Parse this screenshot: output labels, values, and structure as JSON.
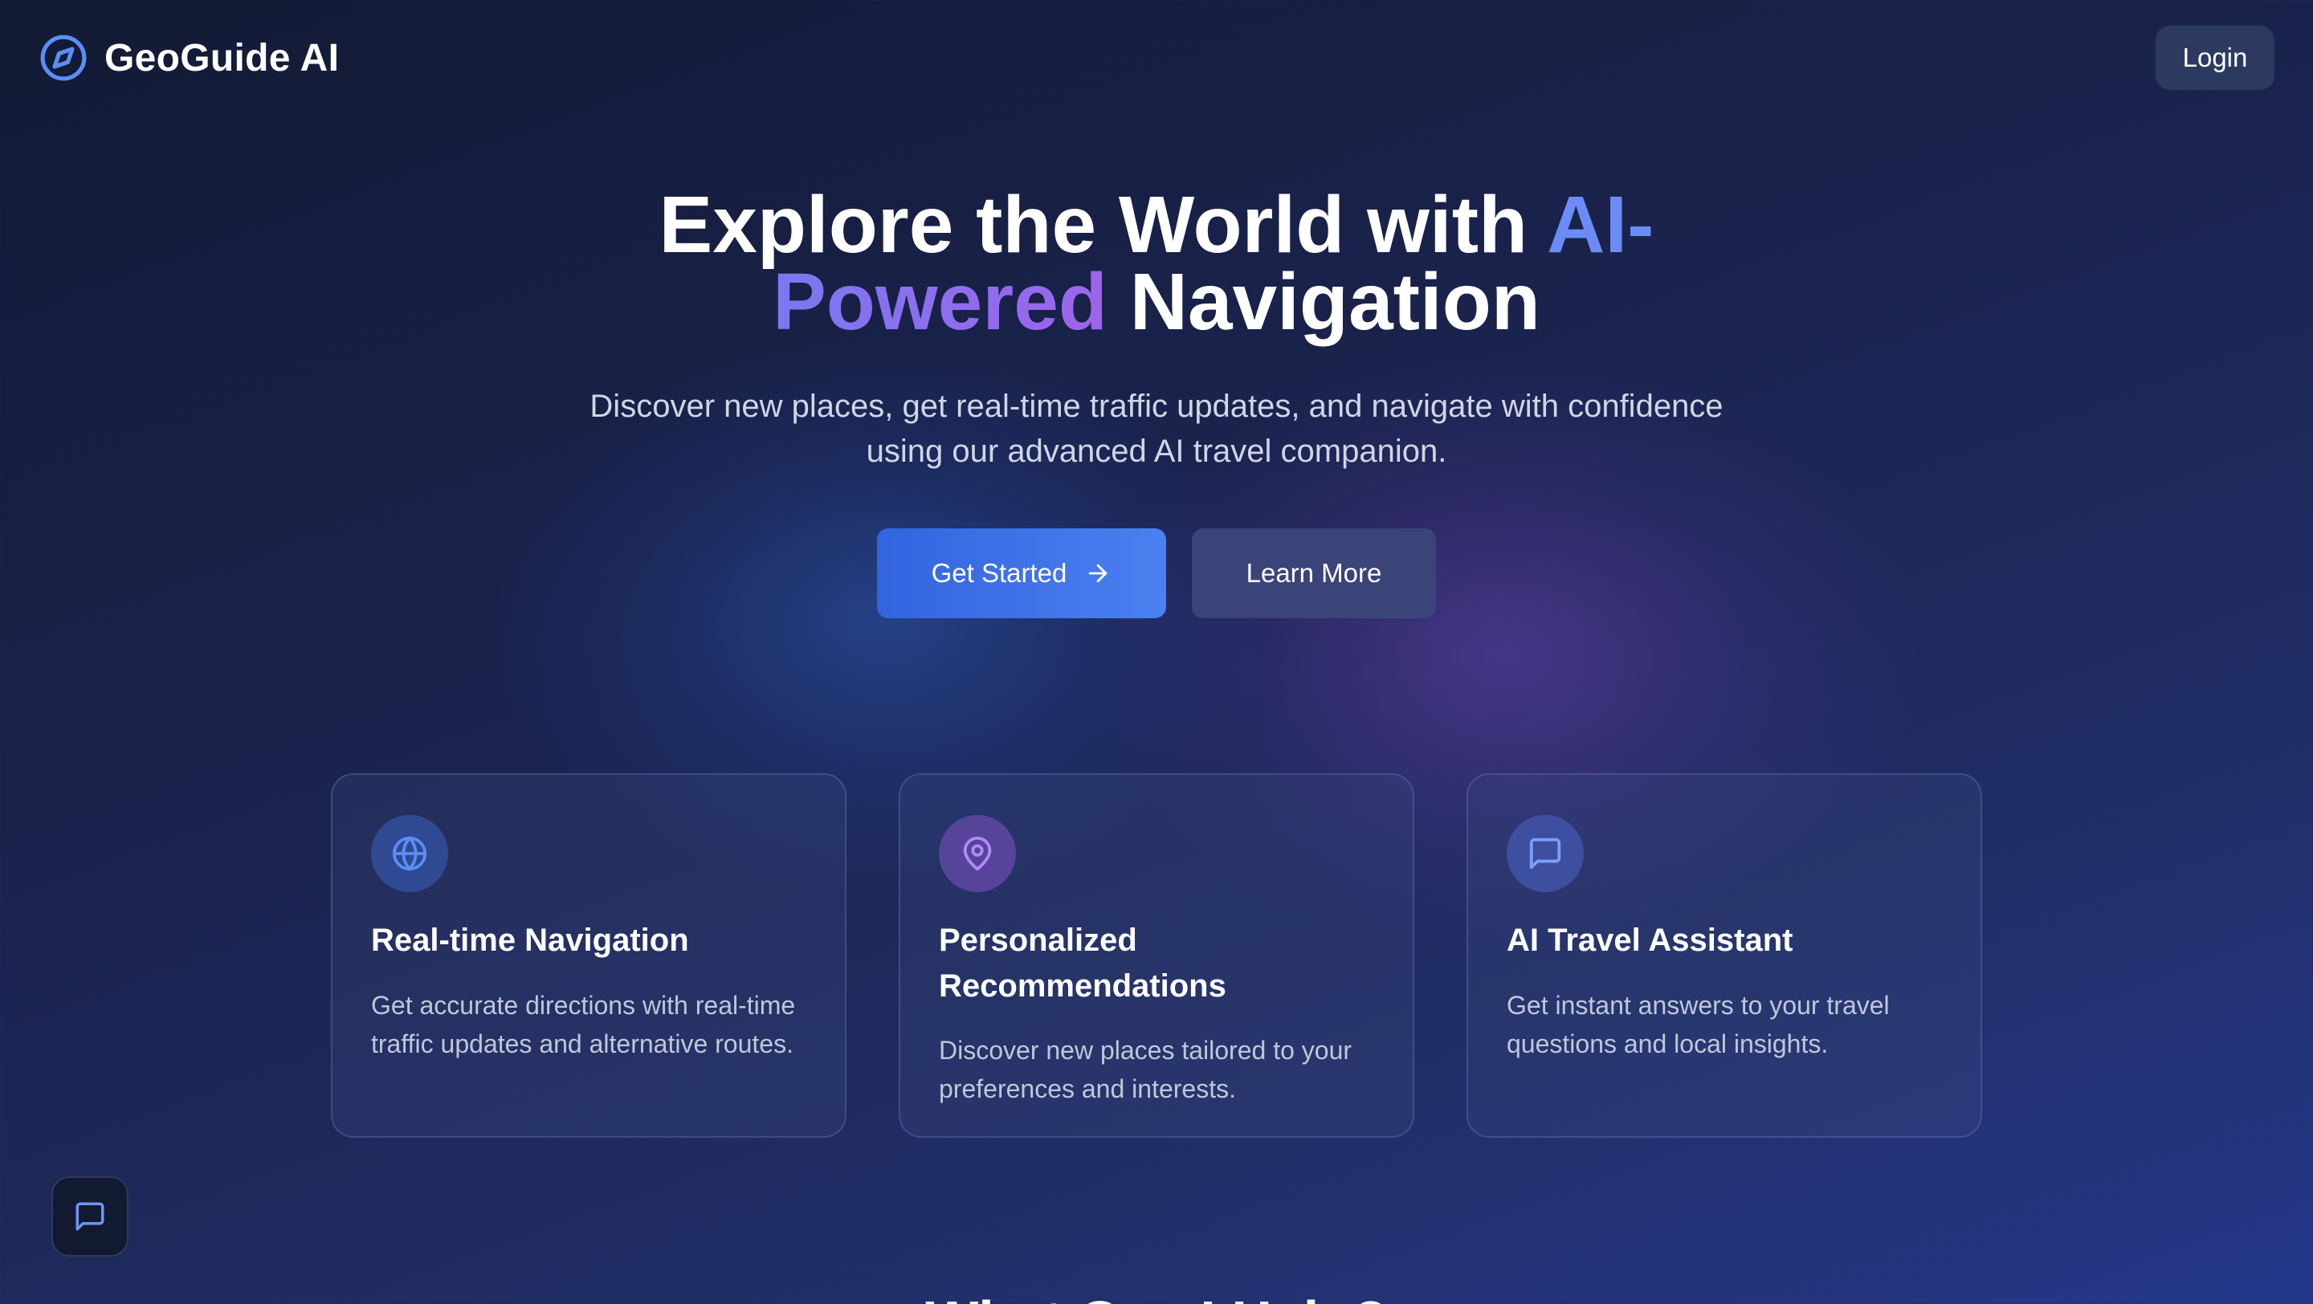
{
  "header": {
    "brand_name": "GeoGuide AI",
    "brand_icon": "compass-icon",
    "login_label": "Login"
  },
  "hero": {
    "title_part1": "Explore the World with ",
    "title_accent1": "AI-",
    "title_accent2": "Powered",
    "title_part2": " Navigation",
    "subtitle_line1": "Discover new places, get real-time traffic updates, and navigate with confidence",
    "subtitle_line2": "using our advanced AI travel companion.",
    "primary_button": "Get Started",
    "primary_button_icon": "arrow-right-icon",
    "secondary_button": "Learn More"
  },
  "features": [
    {
      "icon": "globe-icon",
      "title": "Real-time Navigation",
      "description": "Get accurate directions with real-time traffic updates and alternative routes."
    },
    {
      "icon": "map-pin-icon",
      "title": "Personalized Recommendations",
      "description": "Discover new places tailored to your preferences and interests."
    },
    {
      "icon": "chat-bubble-icon",
      "title": "AI Travel Assistant",
      "description": "Get instant answers to your travel questions and local insights."
    }
  ],
  "chat_fab_icon": "chat-bubble-icon",
  "next_section_heading": "What Can I Help?",
  "colors": {
    "accent_blue": "#6b8cf5",
    "accent_purple": "#9e64ea",
    "primary_button": "#4b80f0",
    "background": "#1b2450"
  }
}
